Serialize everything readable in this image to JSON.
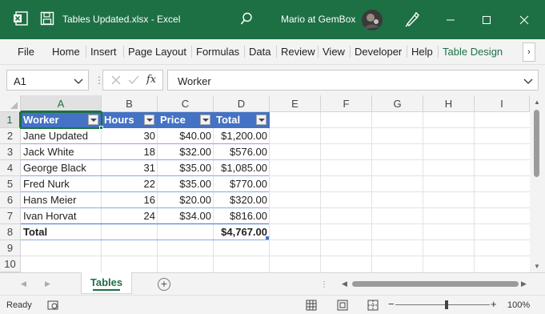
{
  "app": {
    "title": "Tables Updated.xlsx  -  Excel",
    "user": "Mario at GemBox",
    "accent": "#1d7044"
  },
  "ribbon": {
    "tabs": [
      "File",
      "Home",
      "Insert",
      "Page Layout",
      "Formulas",
      "Data",
      "Review",
      "View",
      "Developer",
      "Help",
      "Table Design"
    ],
    "active": "Table Design",
    "scroll_glyph": "›"
  },
  "formula_bar": {
    "name_box": "A1",
    "fx_label": "fx",
    "content": "Worker"
  },
  "grid": {
    "columns": [
      "A",
      "B",
      "C",
      "D",
      "E",
      "F",
      "G",
      "H",
      "I"
    ],
    "rows": [
      "1",
      "2",
      "3",
      "4",
      "5",
      "6",
      "7",
      "8",
      "9",
      "10"
    ],
    "selected_cell": "A1"
  },
  "table": {
    "header_color": "#4472c4",
    "headers": [
      "Worker",
      "Hours",
      "Price",
      "Total"
    ],
    "rows": [
      [
        "Jane Updated",
        "30",
        "$40.00",
        "$1,200.00"
      ],
      [
        "Jack White",
        "18",
        "$32.00",
        "$576.00"
      ],
      [
        "George Black",
        "31",
        "$35.00",
        "$1,085.00"
      ],
      [
        "Fred Nurk",
        "22",
        "$35.00",
        "$770.00"
      ],
      [
        "Hans Meier",
        "16",
        "$20.00",
        "$320.00"
      ],
      [
        "Ivan Horvat",
        "24",
        "$34.00",
        "$816.00"
      ]
    ],
    "total_label": "Total",
    "total_value": "$4,767.00"
  },
  "sheets": {
    "tabs": [
      "Tables"
    ],
    "active": "Tables",
    "add_glyph": "+"
  },
  "status": {
    "ready": "Ready",
    "zoom": "100%",
    "zoom_minus": "−",
    "zoom_plus": "+"
  }
}
